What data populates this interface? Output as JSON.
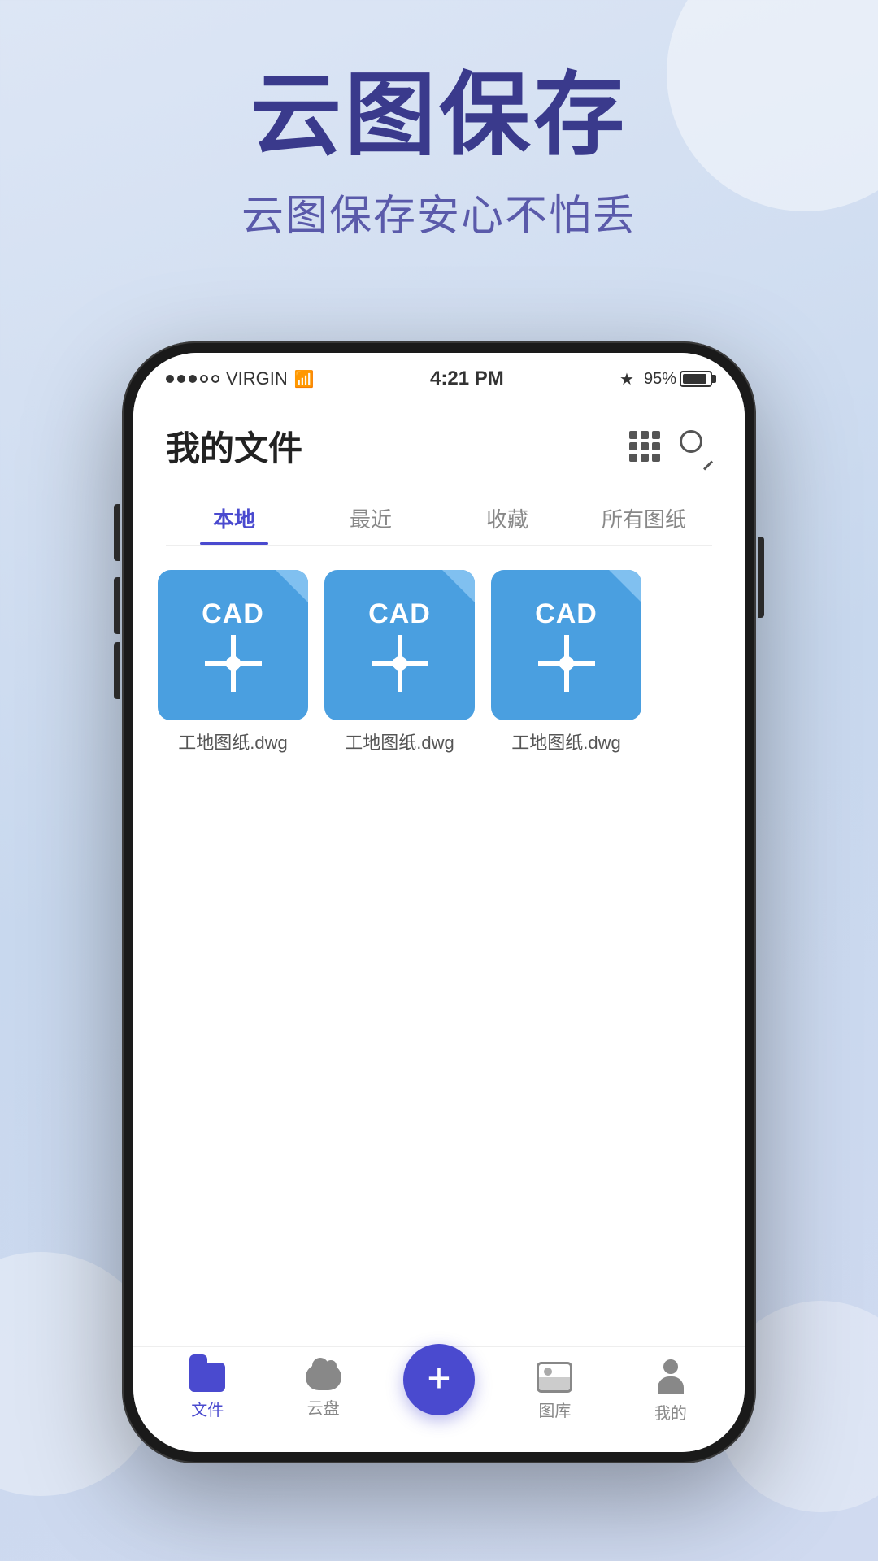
{
  "background": {
    "color": "#dde6f5"
  },
  "hero": {
    "title": "云图保存",
    "subtitle": "云图保存安心不怕丢"
  },
  "phone": {
    "status_bar": {
      "carrier": "VIRGIN",
      "time": "4:21 PM",
      "battery": "95%"
    },
    "header": {
      "title": "我的文件",
      "grid_label": "grid-view",
      "search_label": "search"
    },
    "tabs": [
      {
        "label": "本地",
        "active": true
      },
      {
        "label": "最近",
        "active": false
      },
      {
        "label": "收藏",
        "active": false
      },
      {
        "label": "所有图纸",
        "active": false
      }
    ],
    "files": [
      {
        "name": "工地图纸.dwg",
        "type": "CAD"
      },
      {
        "name": "工地图纸.dwg",
        "type": "CAD"
      },
      {
        "name": "工地图纸.dwg",
        "type": "CAD"
      }
    ],
    "bottom_nav": [
      {
        "label": "文件",
        "active": true,
        "icon": "folder"
      },
      {
        "label": "云盘",
        "active": false,
        "icon": "cloud"
      },
      {
        "label": "",
        "active": false,
        "icon": "plus"
      },
      {
        "label": "图库",
        "active": false,
        "icon": "gallery"
      },
      {
        "label": "我的",
        "active": false,
        "icon": "person"
      }
    ]
  }
}
